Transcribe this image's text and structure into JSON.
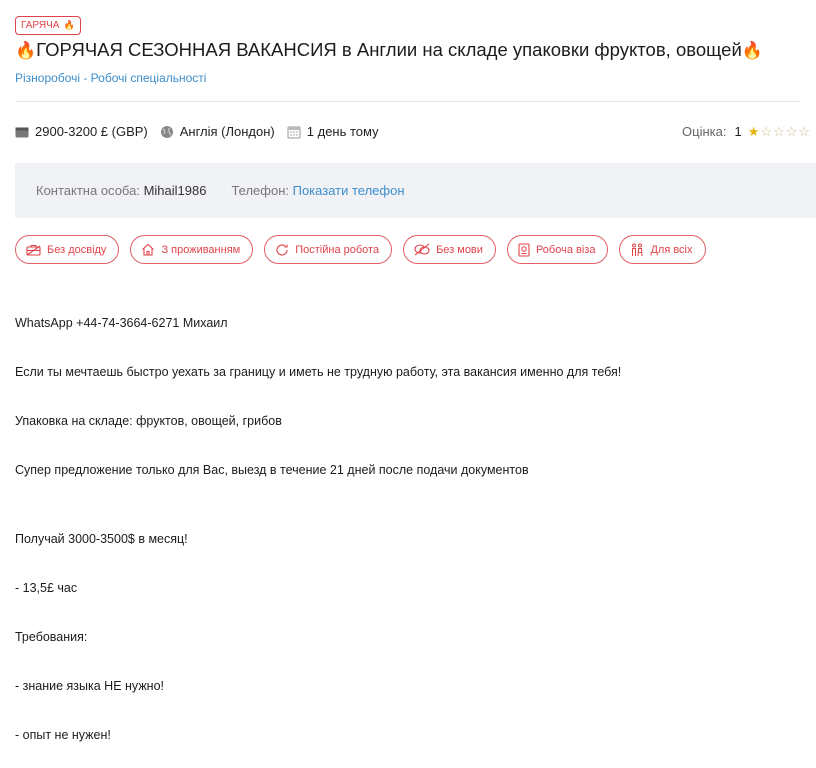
{
  "badge": {
    "label": "ГАРЯЧА",
    "flame": "🔥"
  },
  "job": {
    "title_emoji": "🔥",
    "title": "ГОРЯЧАЯ СЕЗОННАЯ ВАКАНСИЯ в Англии на складе упаковки фруктов, овощей",
    "category": "Різноробочі - Робочі спеціальності"
  },
  "meta": {
    "salary": "2900-3200 £ (GBP)",
    "location": "Англія (Лондон)",
    "posted": "1 день тому",
    "icons": [
      "wallet-icon",
      "globe-icon",
      "calendar-icon"
    ]
  },
  "rating": {
    "label": "Оцінка:",
    "value": "1",
    "stars_filled": 1,
    "stars_total": 5,
    "star_icon": "star-icon"
  },
  "contact": {
    "person_label": "Контактна особа:",
    "person_value": "Mihail1986",
    "phone_label": "Телефон:",
    "phone_link": "Показати телефон"
  },
  "tags": [
    {
      "label": "Без досвіду",
      "icon": "briefcase-icon"
    },
    {
      "label": "З проживанням",
      "icon": "home-icon"
    },
    {
      "label": "Постійна робота",
      "icon": "refresh-icon"
    },
    {
      "label": "Без мови",
      "icon": "no-speech-icon"
    },
    {
      "label": "Робоча віза",
      "icon": "passport-icon"
    },
    {
      "label": "Для всіх",
      "icon": "people-icon"
    }
  ],
  "description": [
    "WhatsApp +44-74-3664-6271 Михаил",
    "Если ты мечтаешь быстро уехать за границу и иметь не трудную работу, эта вакансия именно для тебя!",
    "Упаковка на складе: фруктов, овощей, грибов",
    "Супер предложение только для Вас, выезд в течение 21 дней после подачи документов",
    "Получай 3000-3500$ в месяц!",
    "- 13,5£ час",
    "Требования:",
    "- знание языка НЕ нужно!",
    "- опыт не нужен!"
  ],
  "colors": {
    "accent": "#e0434b",
    "link": "#3d8ecb",
    "contact_bg": "#f0f2f5",
    "star": "#e8b30e"
  }
}
